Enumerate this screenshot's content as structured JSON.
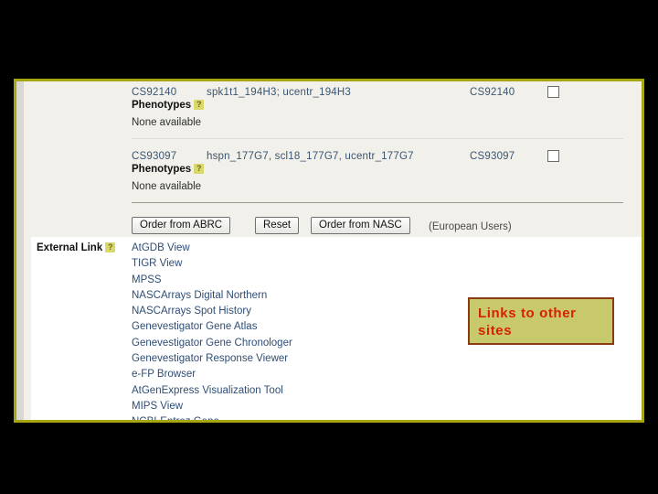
{
  "panel": {
    "germplasm_rows": [
      {
        "stock_id": "CS92140",
        "aliases": "spk1t1_194H3; ucentr_194H3",
        "right_id": "CS92140",
        "checkbox_checked": false,
        "phenotypes_label": "Phenotypes",
        "help_glyph": "?",
        "phenotypes_value": "None available"
      },
      {
        "stock_id": "CS93097",
        "aliases": "hspn_177G7, scl18_177G7, ucentr_177G7",
        "right_id": "CS93097",
        "checkbox_checked": false,
        "phenotypes_label": "Phenotypes",
        "help_glyph": "?",
        "phenotypes_value": "None available"
      }
    ],
    "order_bar": {
      "order_abrc_label": "Order from ABRC",
      "reset_label": "Reset",
      "order_nasc_label": "Order from NASC",
      "european_users_note": "(European Users)"
    },
    "external_link_section": {
      "label": "External Link",
      "help_glyph": "?",
      "links": [
        "AtGDB View",
        "TIGR View",
        "MPSS",
        "NASCArrays Digital Northern",
        "NASCArrays Spot History",
        "Genevestigator Gene Atlas",
        "Genevestigator Gene Chronologer",
        "Genevestigator Response Viewer",
        "e-FP Browser",
        "AtGenExpress Visualization Tool",
        "MIPS View",
        "NCBI-Entrez Gene"
      ]
    }
  },
  "callout": {
    "text": "Links to other sites",
    "background_color": "#c8c86c",
    "border_color": "#8a3a10",
    "text_color": "#d62200"
  },
  "colors": {
    "frame_border": "#a6a610",
    "panel_background": "#f1f0ea",
    "links_background": "#ffffff",
    "link_text": "#2f4d74",
    "slide_background": "#000000"
  }
}
